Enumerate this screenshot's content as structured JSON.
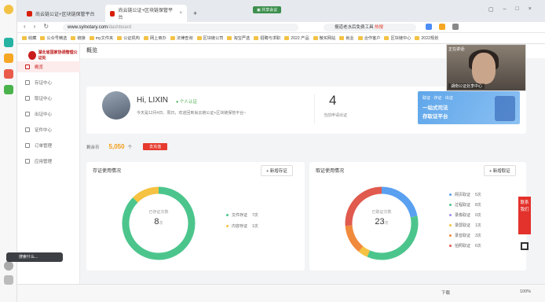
{
  "browser": {
    "tabs": [
      {
        "label": "尚云链公证+区块链保管平台"
      },
      {
        "label": "尚云链公证+区块链保管平台"
      }
    ],
    "url_domain": "www.sylnotary.com",
    "url_path": "/dashboard",
    "search_text": "报道老水后免费工具 ",
    "search_hot": "热搜",
    "sharing_badge": "▣ 共享会议",
    "bookmarks": [
      "收藏",
      "公众号精选",
      "链接",
      "my文件夹",
      "公证机构",
      "网上商办",
      "法律查询",
      "区块链公司",
      "淘宝严选",
      "招聘与求职",
      "2022 产品",
      "微买网站",
      "就业",
      "合作客户",
      "区块链中心",
      "2022规划"
    ]
  },
  "app": {
    "logo_text": "湖北省国家协调管理公证处",
    "menu": [
      {
        "label": "概览",
        "active": true
      },
      {
        "label": "存证中心",
        "active": false
      },
      {
        "label": "取证中心",
        "active": false
      },
      {
        "label": "出证中心",
        "active": false
      },
      {
        "label": "证件中心",
        "active": false
      },
      {
        "label": "订单管理",
        "active": false
      },
      {
        "label": "应用管理",
        "active": false
      }
    ],
    "page_title": "概览"
  },
  "profile": {
    "greeting": "Hi, LIXIN",
    "cert_label": "个人认证",
    "welcome": "今天是12月4日、周日，欢迎回到尚云链公证+区块链保管平台~",
    "apply_count": "4",
    "apply_label": "当前申请出证"
  },
  "banner": {
    "line1": "取证 · 存证 · 出证",
    "line2": "一站式司法",
    "line3": "存取证平台"
  },
  "balance": {
    "label": "剩余币",
    "value": "5,050",
    "unit": "个",
    "recharge": "去充值"
  },
  "deposit": {
    "title": "存证使用情况",
    "new_button": "+ 新增存证",
    "center_label": "已存证次数",
    "total": "8",
    "unit": "次",
    "legend": [
      {
        "label": "文件存证",
        "value": "7次",
        "color": "#4cc58d"
      },
      {
        "label": "内容存证",
        "value": "1次",
        "color": "#f5c242"
      }
    ]
  },
  "evidence": {
    "title": "取证使用情况",
    "new_button": "+ 新增取证",
    "center_label": "已取证次数",
    "total": "23",
    "unit": "次",
    "legend": [
      {
        "label": "网页取证",
        "value": "5次",
        "color": "#5aa0f0"
      },
      {
        "label": "过程取证",
        "value": "8次",
        "color": "#4cc58d"
      },
      {
        "label": "录像取证",
        "value": "0次",
        "color": "#9b8ef0"
      },
      {
        "label": "录屏取证",
        "value": "1次",
        "color": "#f5c242"
      },
      {
        "label": "录音取证",
        "value": "3次",
        "color": "#f08a3c"
      },
      {
        "label": "拍照取证",
        "value": "6次",
        "color": "#e05a4e"
      }
    ]
  },
  "video": {
    "caption": "湖南公证处李中心",
    "presenter": "正在讲话:"
  },
  "side_service": "联系我们",
  "pill_text": "搜索什么...",
  "status_bar": {
    "zoom": "100%",
    "download": "下载"
  }
}
